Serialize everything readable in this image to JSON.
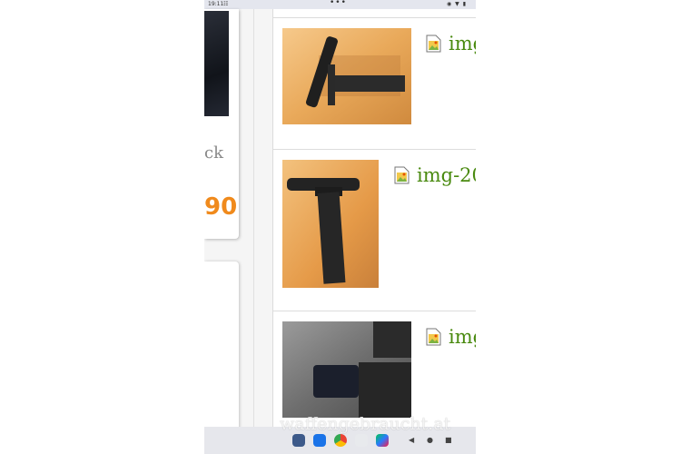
{
  "statusbar": {
    "time": "19:11",
    "notif": "☷",
    "dots": "•••",
    "icons": "◉ ▼ ▮"
  },
  "left_column": {
    "partial_text": "ck",
    "partial_price": "90"
  },
  "attachments": [
    {
      "name": "img",
      "icon": "image-file-icon"
    },
    {
      "name": "img-20",
      "icon": "image-file-icon"
    },
    {
      "name": "img",
      "icon": "image-file-icon"
    }
  ],
  "dock": {
    "apps": [
      "camera-icon",
      "messages-icon",
      "chrome-icon",
      "assistant-icon",
      "play-store-icon"
    ]
  },
  "nav": {
    "back": "◀",
    "home": "●",
    "recents": "■"
  },
  "watermark": "waffengebraucht.at",
  "colors": {
    "link": "#4a8a10",
    "price": "#f08a1c",
    "statusbar": "#e4e6ee"
  }
}
